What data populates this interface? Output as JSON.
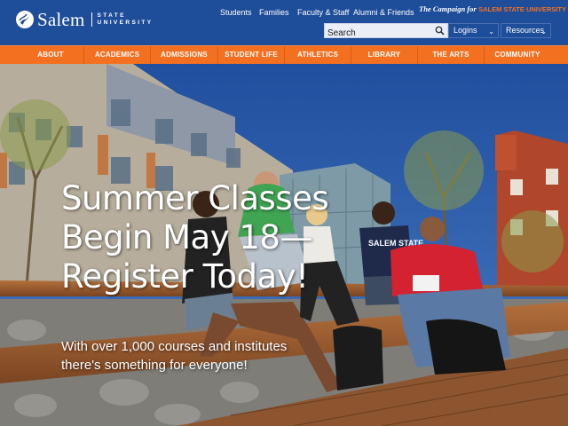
{
  "header": {
    "logo_name": "Salem",
    "logo_sub_line1": "STATE",
    "logo_sub_line2": "UNIVERSITY",
    "utility_links": [
      "Students",
      "Families",
      "Faculty & Staff",
      "Alumni & Friends"
    ],
    "campaign_prefix": "The Campaign for",
    "campaign_name": "SALEM STATE UNIVERSITY",
    "search_placeholder": "Search",
    "logins_label": "Logins",
    "resources_label": "Resources"
  },
  "nav": {
    "items": [
      "ABOUT",
      "ACADEMICS",
      "ADMISSIONS",
      "STUDENT LIFE",
      "ATHLETICS",
      "LIBRARY",
      "THE ARTS",
      "COMMUNITY"
    ]
  },
  "hero": {
    "title": "Summer Classes Begin May 18—Register Today!",
    "subtitle": "With over 1,000 courses and institutes there's something for everyone!",
    "shirt_text": "SALEM STATE"
  },
  "colors": {
    "header_blue": "#1e4d9a",
    "nav_orange": "#f37021"
  },
  "icons": [
    "logo-flame-icon",
    "search-icon",
    "chevron-down-icon"
  ]
}
